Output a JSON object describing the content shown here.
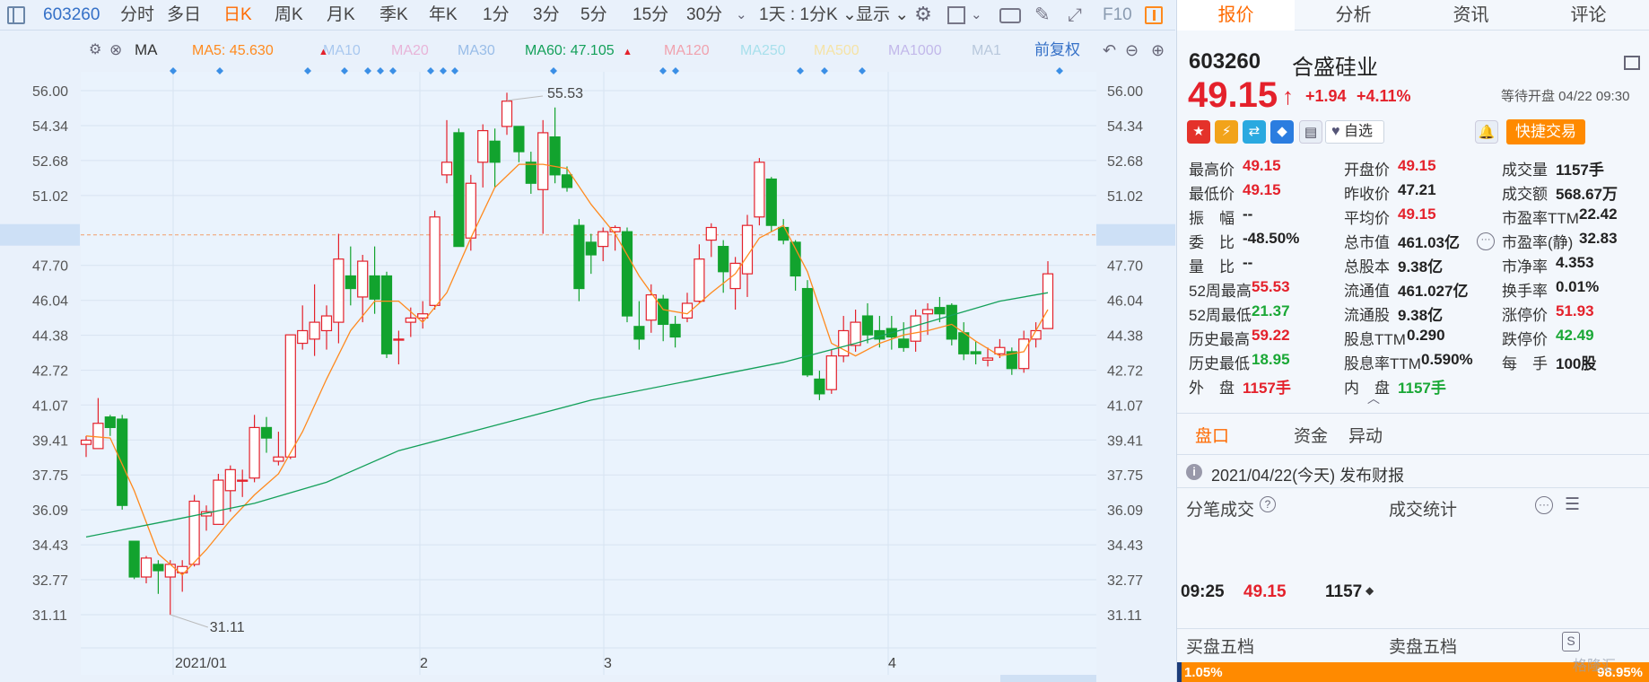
{
  "toolbar": {
    "code": "603260",
    "periods": [
      "分时",
      "多日",
      "日K",
      "周K",
      "月K",
      "季K",
      "年K",
      "1分",
      "3分",
      "5分",
      "15分",
      "30分"
    ],
    "active": "日K",
    "dropdown": "1天 : 1分K",
    "display": "显示",
    "f10": "F10"
  },
  "ma_bar": {
    "label": "MA",
    "items": [
      "MA5: 45.630",
      "MA10",
      "MA20",
      "MA30",
      "MA60: 47.105",
      "MA120",
      "MA250",
      "MA500",
      "MA1000",
      "MA1"
    ],
    "adjust": "前复权"
  },
  "price_axis": {
    "ticks": [
      "56.00",
      "54.34",
      "52.68",
      "51.02",
      "49.15",
      "47.70",
      "46.04",
      "44.38",
      "42.72",
      "41.07",
      "39.41",
      "37.75",
      "36.09",
      "34.43",
      "32.77",
      "31.11"
    ],
    "current": "49.15"
  },
  "chart_data": {
    "type": "candlestick",
    "ylim": [
      30.1,
      57.0
    ],
    "x_labels": [
      "2021/01",
      "2",
      "3",
      "4"
    ],
    "annotations": {
      "high": "55.53",
      "low": "31.11"
    },
    "candles": [
      [
        39.2,
        39.4,
        38.6,
        39.6
      ],
      [
        39.0,
        40.2,
        39.6,
        41.4
      ],
      [
        40.5,
        40.0,
        39.6,
        40.6
      ],
      [
        40.4,
        36.3,
        36.1,
        40.6
      ],
      [
        34.6,
        32.9,
        32.8,
        34.6
      ],
      [
        32.9,
        33.8,
        32.6,
        33.9
      ],
      [
        33.5,
        33.2,
        32.1,
        33.7
      ],
      [
        32.9,
        33.5,
        31.1,
        33.7
      ],
      [
        33.1,
        33.4,
        32.2,
        33.7
      ],
      [
        33.5,
        36.5,
        33.4,
        36.8
      ],
      [
        35.8,
        36.0,
        35.1,
        36.3
      ],
      [
        35.4,
        37.5,
        35.4,
        37.8
      ],
      [
        37.0,
        38.0,
        36.0,
        38.2
      ],
      [
        37.5,
        37.5,
        36.7,
        38.0
      ],
      [
        37.6,
        40.0,
        37.4,
        40.6
      ],
      [
        40.0,
        39.5,
        38.8,
        40.5
      ],
      [
        38.4,
        38.6,
        38.2,
        39.8
      ],
      [
        38.6,
        44.4,
        38.5,
        44.4
      ],
      [
        44.0,
        44.6,
        43.7,
        45.8
      ],
      [
        44.2,
        45.0,
        43.4,
        46.8
      ],
      [
        44.6,
        45.3,
        43.7,
        45.8
      ],
      [
        45.0,
        48.0,
        44.0,
        49.2
      ],
      [
        47.2,
        46.6,
        45.8,
        48.6
      ],
      [
        46.2,
        47.9,
        45.0,
        48.2
      ],
      [
        47.2,
        46.1,
        45.4,
        48.6
      ],
      [
        47.2,
        43.5,
        43.3,
        47.4
      ],
      [
        44.2,
        44.2,
        43.0,
        44.6
      ],
      [
        45.0,
        45.2,
        44.3,
        45.7
      ],
      [
        45.2,
        45.4,
        44.7,
        46.0
      ],
      [
        45.8,
        50.0,
        45.6,
        50.3
      ],
      [
        52.0,
        52.6,
        51.6,
        54.6
      ],
      [
        54.0,
        48.6,
        48.6,
        54.2
      ],
      [
        49.0,
        51.6,
        48.4,
        52.0
      ],
      [
        52.6,
        54.1,
        51.4,
        54.4
      ],
      [
        53.6,
        52.6,
        51.4,
        54.2
      ],
      [
        54.3,
        55.5,
        53.9,
        55.9
      ],
      [
        54.3,
        53.1,
        52.6,
        54.3
      ],
      [
        52.6,
        51.6,
        51.1,
        53.1
      ],
      [
        51.3,
        54.0,
        49.2,
        54.6
      ],
      [
        53.8,
        52.0,
        51.6,
        55.2
      ],
      [
        52.0,
        51.4,
        51.2,
        52.4
      ],
      [
        49.6,
        46.6,
        46.0,
        49.9
      ],
      [
        48.8,
        48.2,
        47.3,
        49.2
      ],
      [
        48.6,
        49.3,
        47.9,
        49.5
      ],
      [
        49.3,
        49.5,
        48.4,
        49.6
      ],
      [
        49.3,
        45.3,
        45.0,
        49.5
      ],
      [
        44.8,
        44.2,
        43.7,
        46.0
      ],
      [
        45.1,
        46.3,
        44.5,
        46.8
      ],
      [
        46.1,
        44.9,
        44.1,
        46.3
      ],
      [
        44.9,
        44.3,
        43.8,
        45.3
      ],
      [
        45.2,
        45.9,
        45.0,
        46.4
      ],
      [
        46.0,
        48.0,
        45.9,
        48.7
      ],
      [
        48.9,
        49.5,
        48.1,
        49.7
      ],
      [
        48.6,
        47.4,
        46.4,
        48.9
      ],
      [
        46.6,
        47.8,
        45.6,
        48.1
      ],
      [
        47.3,
        49.6,
        46.2,
        50.1
      ],
      [
        50.0,
        52.6,
        49.6,
        52.8
      ],
      [
        51.8,
        49.6,
        49.3,
        51.9
      ],
      [
        49.5,
        48.9,
        48.7,
        49.9
      ],
      [
        48.8,
        47.2,
        46.5,
        48.9
      ],
      [
        46.6,
        42.5,
        42.4,
        47.0
      ],
      [
        42.3,
        41.6,
        41.3,
        42.7
      ],
      [
        41.8,
        43.4,
        41.6,
        43.7
      ],
      [
        43.4,
        44.6,
        43.1,
        45.3
      ],
      [
        43.9,
        45.0,
        43.6,
        45.6
      ],
      [
        45.3,
        44.4,
        44.0,
        45.9
      ],
      [
        44.6,
        44.2,
        43.8,
        45.3
      ],
      [
        44.7,
        44.3,
        43.7,
        45.3
      ],
      [
        44.2,
        43.8,
        43.6,
        45.0
      ],
      [
        44.1,
        45.3,
        43.6,
        45.6
      ],
      [
        45.4,
        45.6,
        44.4,
        45.9
      ],
      [
        45.7,
        45.4,
        45.0,
        46.2
      ],
      [
        45.8,
        44.2,
        43.9,
        45.9
      ],
      [
        44.5,
        43.5,
        43.2,
        45.0
      ],
      [
        43.6,
        43.5,
        43.0,
        44.1
      ],
      [
        43.2,
        43.3,
        42.9,
        43.8
      ],
      [
        43.5,
        43.8,
        43.3,
        44.2
      ],
      [
        43.6,
        42.8,
        42.5,
        43.8
      ],
      [
        42.8,
        44.2,
        42.6,
        44.6
      ],
      [
        44.2,
        44.6,
        43.8,
        45.0
      ],
      [
        44.7,
        47.3,
        44.7,
        47.9
      ]
    ],
    "ma5": [
      [
        0,
        39.6
      ],
      [
        2,
        39.5
      ],
      [
        4,
        37.0
      ],
      [
        6,
        34.0
      ],
      [
        8,
        33.0
      ],
      [
        10,
        34.2
      ],
      [
        12,
        35.6
      ],
      [
        14,
        36.8
      ],
      [
        16,
        37.8
      ],
      [
        18,
        39.8
      ],
      [
        20,
        42.3
      ],
      [
        22,
        44.6
      ],
      [
        24,
        46.0
      ],
      [
        26,
        46.0
      ],
      [
        28,
        45.0
      ],
      [
        30,
        46.4
      ],
      [
        32,
        49.0
      ],
      [
        34,
        51.4
      ],
      [
        36,
        52.5
      ],
      [
        38,
        52.5
      ],
      [
        40,
        52.3
      ],
      [
        42,
        50.6
      ],
      [
        44,
        49.2
      ],
      [
        46,
        47.2
      ],
      [
        48,
        45.6
      ],
      [
        50,
        45.4
      ],
      [
        52,
        46.4
      ],
      [
        54,
        47.3
      ],
      [
        56,
        49.0
      ],
      [
        58,
        49.6
      ],
      [
        60,
        47.4
      ],
      [
        62,
        44.0
      ],
      [
        64,
        43.4
      ],
      [
        66,
        44.0
      ],
      [
        68,
        44.4
      ],
      [
        70,
        44.6
      ],
      [
        72,
        44.9
      ],
      [
        74,
        44.1
      ],
      [
        76,
        43.4
      ],
      [
        78,
        43.6
      ],
      [
        80,
        45.6
      ]
    ],
    "ma60": [
      [
        0,
        34.8
      ],
      [
        8,
        35.7
      ],
      [
        14,
        36.4
      ],
      [
        20,
        37.4
      ],
      [
        26,
        38.9
      ],
      [
        34,
        40.1
      ],
      [
        42,
        41.3
      ],
      [
        50,
        42.2
      ],
      [
        58,
        43.1
      ],
      [
        64,
        44.0
      ],
      [
        70,
        45.0
      ],
      [
        76,
        46.0
      ],
      [
        80,
        46.4
      ]
    ]
  },
  "right": {
    "tabs": [
      "报价",
      "分析",
      "资讯",
      "评论"
    ],
    "code": "603260",
    "name": "合盛硅业",
    "price": "49.15",
    "arrow": "↑",
    "change": "+1.94",
    "pct": "+4.11%",
    "status": "等待开盘 04/22 09:30",
    "watch": "自选",
    "trade": "快捷交易",
    "stats": [
      [
        [
          "最高价",
          "49.15",
          "red"
        ],
        [
          "开盘价",
          "49.15",
          "red"
        ],
        [
          "成交量",
          "1157手",
          "dark"
        ]
      ],
      [
        [
          "最低价",
          "49.15",
          "red"
        ],
        [
          "昨收价",
          "47.21",
          "dark"
        ],
        [
          "成交额",
          "568.67万",
          "dark"
        ]
      ],
      [
        [
          "振　幅",
          "--",
          "dark"
        ],
        [
          "平均价",
          "49.15",
          "red"
        ],
        [
          "市盈率TTM",
          "22.42",
          "dark"
        ]
      ],
      [
        [
          "委　比",
          "-48.50%",
          "dark"
        ],
        [
          "总市值",
          "461.03亿",
          "dark"
        ],
        [
          "市盈率(静)",
          "32.83",
          "dark"
        ]
      ],
      [
        [
          "量　比",
          "--",
          "dark"
        ],
        [
          "总股本",
          "9.38亿",
          "dark"
        ],
        [
          "市净率",
          "4.353",
          "dark"
        ]
      ],
      [
        [
          "52周最高",
          "55.53",
          "red"
        ],
        [
          "流通值",
          "461.027亿",
          "dark"
        ],
        [
          "换手率",
          "0.01%",
          "dark"
        ]
      ],
      [
        [
          "52周最低",
          "21.37",
          "green"
        ],
        [
          "流通股",
          "9.38亿",
          "dark"
        ],
        [
          "涨停价",
          "51.93",
          "red"
        ]
      ],
      [
        [
          "历史最高",
          "59.22",
          "red"
        ],
        [
          "股息TTM",
          "0.290",
          "dark"
        ],
        [
          "跌停价",
          "42.49",
          "green"
        ]
      ],
      [
        [
          "历史最低",
          "18.95",
          "green"
        ],
        [
          "股息率TTM",
          "0.590%",
          "dark"
        ],
        [
          "每　手",
          "100股",
          "dark"
        ]
      ],
      [
        [
          "外　盘",
          "1157手",
          "red"
        ],
        [
          "内　盘",
          "1157手",
          "green"
        ]
      ]
    ],
    "subtabs": [
      "盘口",
      "资金",
      "异动"
    ],
    "notice": "2021/04/22(今天) 发布财报",
    "tick_title": "分笔成交",
    "stat_title": "成交统计",
    "tick": {
      "time": "09:25",
      "price": "49.15",
      "vol": "1157"
    },
    "bid_title": "买盘五档",
    "ask_title": "卖盘五档",
    "bid_pct": "1.05%",
    "ask_pct": "98.95%",
    "watermark": "格隆汇"
  }
}
